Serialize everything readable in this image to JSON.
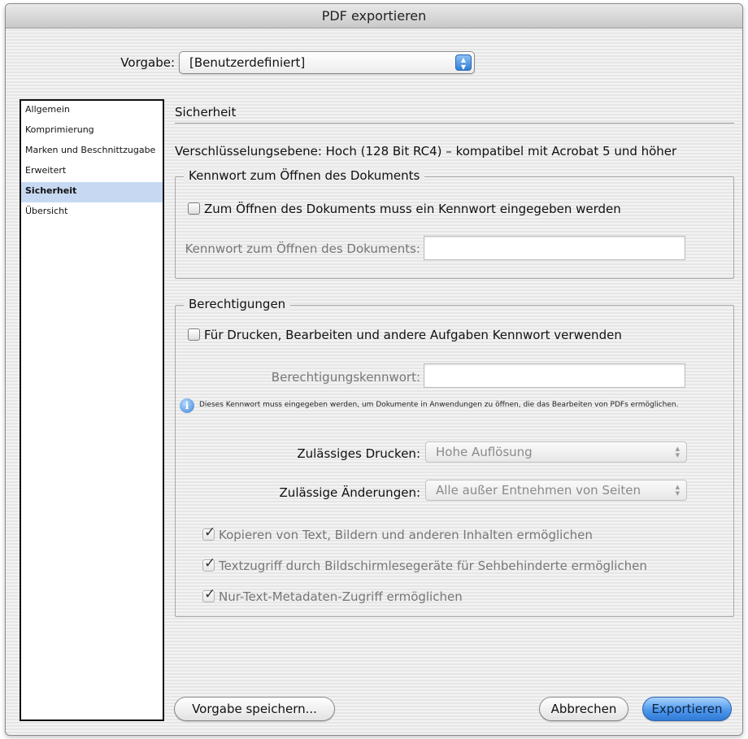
{
  "window": {
    "title": "PDF exportieren"
  },
  "preset": {
    "label": "Vorgabe:",
    "value": "[Benutzerdefiniert]"
  },
  "sidebar": {
    "items": [
      {
        "label": "Allgemein"
      },
      {
        "label": "Komprimierung"
      },
      {
        "label": "Marken und Beschnittzugabe"
      },
      {
        "label": "Erweitert"
      },
      {
        "label": "Sicherheit",
        "selected": true
      },
      {
        "label": "Übersicht"
      }
    ]
  },
  "main": {
    "section_title": "Sicherheit",
    "encryption_text": "Verschlüsselungsebene: Hoch (128 Bit RC4) – kompatibel mit Acrobat 5 und höher",
    "open_group": {
      "legend": "Kennwort zum Öffnen des Dokuments",
      "checkbox_label": "Zum Öffnen des Dokuments muss ein Kennwort eingegeben werden",
      "checkbox_checked": false,
      "field_label": "Kennwort zum Öffnen des Dokuments:",
      "field_value": ""
    },
    "permissions": {
      "legend": "Berechtigungen",
      "checkbox_label": "Für Drucken, Bearbeiten und andere Aufgaben Kennwort verwenden",
      "checkbox_checked": false,
      "field_label": "Berechtigungskennwort:",
      "field_value": "",
      "info_text": "Dieses Kennwort muss eingegeben werden, um Dokumente in Anwendungen zu öffnen, die das Bearbeiten von PDFs ermöglichen.",
      "printing_label": "Zulässiges Drucken:",
      "printing_value": "Hohe Auflösung",
      "changes_label": "Zulässige Änderungen:",
      "changes_value": "Alle außer Entnehmen von Seiten",
      "options": [
        {
          "label": "Kopieren von Text, Bildern und anderen Inhalten ermöglichen",
          "checked": true
        },
        {
          "label": "Textzugriff durch Bildschirmlesegeräte für Sehbehinderte ermöglichen",
          "checked": true
        },
        {
          "label": "Nur-Text-Metadaten-Zugriff ermöglichen",
          "checked": true
        }
      ]
    }
  },
  "buttons": {
    "save_preset": "Vorgabe speichern...",
    "cancel": "Abbrechen",
    "export": "Exportieren"
  }
}
